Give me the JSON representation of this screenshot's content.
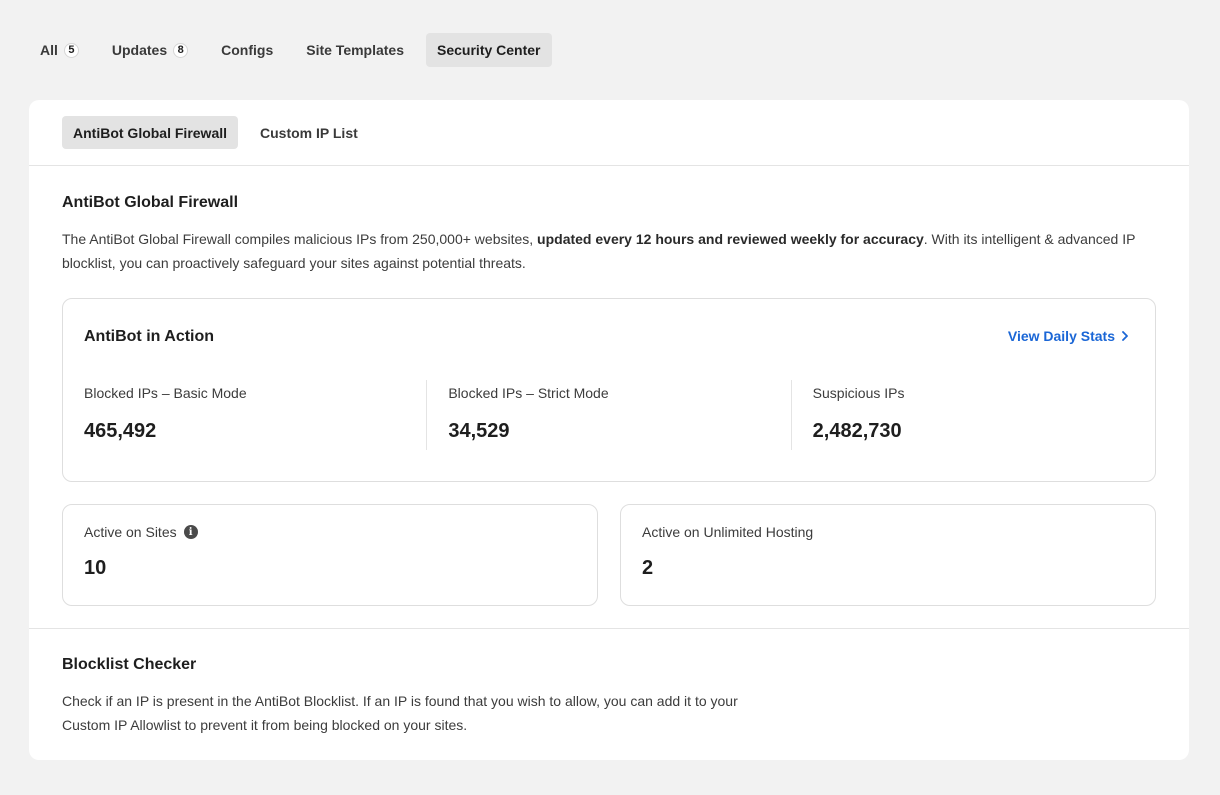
{
  "top_tabs": [
    {
      "label": "All",
      "badge": "5"
    },
    {
      "label": "Updates",
      "badge": "8"
    },
    {
      "label": "Configs"
    },
    {
      "label": "Site Templates"
    },
    {
      "label": "Security Center",
      "active": true
    }
  ],
  "sub_tabs": [
    {
      "label": "AntiBot Global Firewall",
      "active": true
    },
    {
      "label": "Custom IP List"
    }
  ],
  "firewall": {
    "title": "AntiBot Global Firewall",
    "desc_pre": "The AntiBot Global Firewall compiles malicious IPs from 250,000+ websites, ",
    "desc_bold": "updated every 12 hours and reviewed weekly for accuracy",
    "desc_post": ". With its intelligent & advanced IP blocklist, you can proactively safeguard your sites against potential threats."
  },
  "action": {
    "title": "AntiBot in Action",
    "link_label": "View Daily Stats",
    "link_icon": "chevron-right-icon",
    "stats": [
      {
        "label": "Blocked IPs – Basic Mode",
        "value": "465,492"
      },
      {
        "label": "Blocked IPs – Strict Mode",
        "value": "34,529"
      },
      {
        "label": "Suspicious IPs",
        "value": "2,482,730"
      }
    ]
  },
  "active_sites": {
    "label": "Active on Sites",
    "value": "10",
    "icon": "info-icon"
  },
  "active_hosting": {
    "label": "Active on Unlimited Hosting",
    "value": "2"
  },
  "blocklist": {
    "title": "Blocklist Checker",
    "desc": "Check if an IP is present in the AntiBot Blocklist. If an IP is found that you wish to allow, you can add it to your Custom IP Allowlist to prevent it from being blocked on your sites."
  },
  "colors": {
    "accent_link": "#1a66d6",
    "page_bg": "#f2f2f2",
    "active_tab_bg": "#e3e3e3"
  }
}
